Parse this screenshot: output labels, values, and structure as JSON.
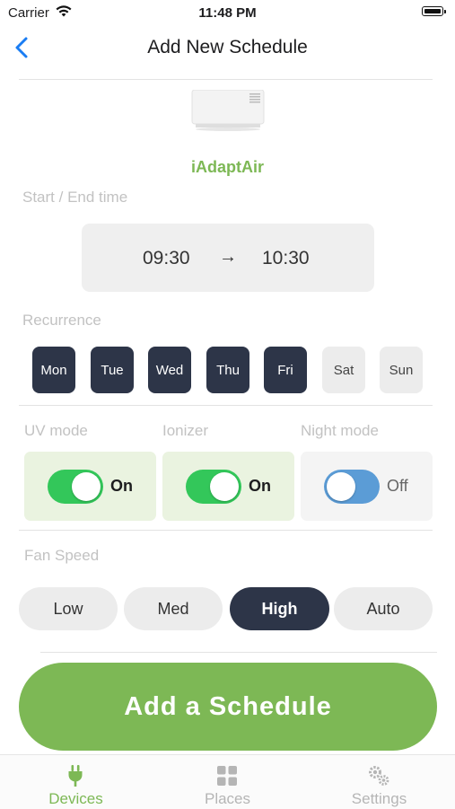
{
  "status_bar": {
    "carrier": "Carrier",
    "time": "11:48 PM"
  },
  "nav": {
    "title": "Add New Schedule"
  },
  "device": {
    "name": "iAdaptAir"
  },
  "time_section": {
    "label": "Start / End time",
    "start": "09:30",
    "arrow": "→",
    "end": "10:30"
  },
  "recurrence": {
    "label": "Recurrence",
    "days": [
      {
        "label": "Mon",
        "selected": true
      },
      {
        "label": "Tue",
        "selected": true
      },
      {
        "label": "Wed",
        "selected": true
      },
      {
        "label": "Thu",
        "selected": true
      },
      {
        "label": "Fri",
        "selected": true
      },
      {
        "label": "Sat",
        "selected": false
      },
      {
        "label": "Sun",
        "selected": false
      }
    ]
  },
  "modes": [
    {
      "label": "UV mode",
      "state": "On",
      "enabled": true
    },
    {
      "label": "Ionizer",
      "state": "On",
      "enabled": true
    },
    {
      "label": "Night mode",
      "state": "Off",
      "enabled": false
    }
  ],
  "fan_speed": {
    "label": "Fan Speed",
    "options": [
      "Low",
      "Med",
      "High",
      "Auto"
    ],
    "selected": "High"
  },
  "add_button": "Add a Schedule",
  "tabs": [
    {
      "label": "Devices",
      "icon": "plug-icon",
      "active": true
    },
    {
      "label": "Places",
      "icon": "grid-icon",
      "active": false
    },
    {
      "label": "Settings",
      "icon": "gears-icon",
      "active": false
    }
  ],
  "colors": {
    "accent_green": "#7db855",
    "selected_dark": "#2d3548",
    "toggle_on": "#33c75a",
    "toggle_off": "#5b9cd6",
    "ios_blue": "#1a7df3"
  }
}
